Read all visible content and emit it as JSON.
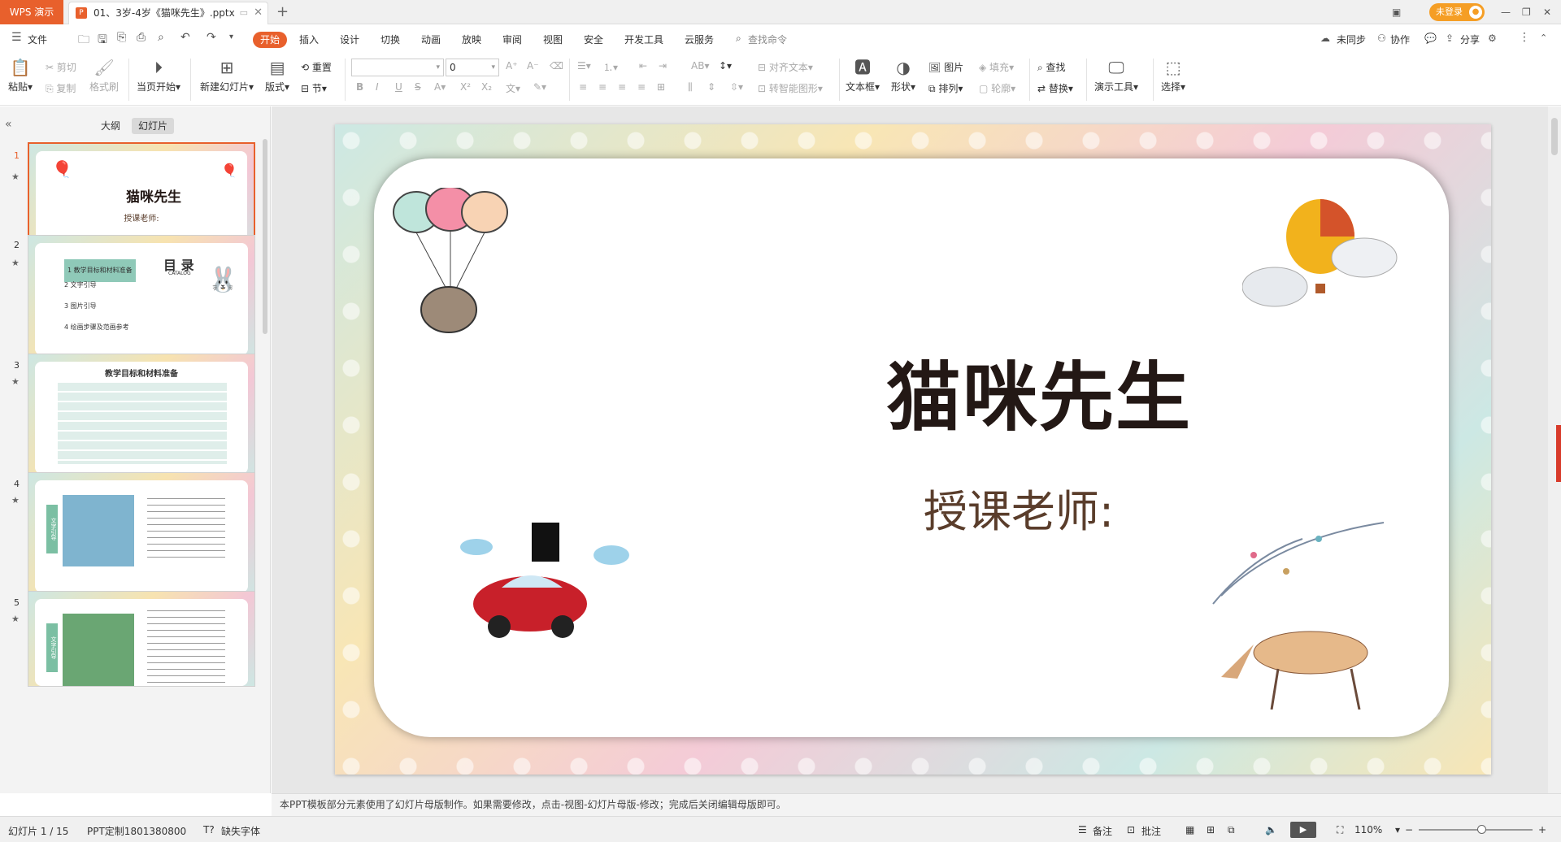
{
  "window": {
    "app_tab": "WPS 演示",
    "doc_tab": "01、3岁-4岁《猫咪先生》.pptx",
    "login_label": "未登录",
    "colors": {
      "accent": "#e8602c",
      "login": "#f59e25",
      "slide_title": "#231815",
      "slide_sub": "#5a3d2b"
    }
  },
  "menu": {
    "file": "文件",
    "items": [
      "开始",
      "插入",
      "设计",
      "切换",
      "动画",
      "放映",
      "审阅",
      "视图",
      "安全",
      "开发工具",
      "云服务"
    ],
    "search": "查找命令",
    "right": {
      "sync": "未同步",
      "collab": "协作",
      "share": "分享"
    }
  },
  "ribbon": {
    "paste": "粘贴",
    "cut": "剪切",
    "copy": "复制",
    "format_painter": "格式刷",
    "play_from_current": "当页开始",
    "new_slide": "新建幻灯片",
    "layout": "版式",
    "reset": "重置",
    "section": "节",
    "font_size": "0",
    "align_text": "对齐文本",
    "smartart": "转智能图形",
    "textbox": "文本框",
    "shape": "形状",
    "picture": "图片",
    "arrange": "排列",
    "fill": "填充",
    "outline": "轮廓",
    "find": "查找",
    "replace": "替换",
    "present_tools": "演示工具",
    "select": "选择"
  },
  "pane": {
    "tab_outline": "大纲",
    "tab_slides": "幻灯片",
    "slides": [
      {
        "num": "1",
        "title": "猫咪先生",
        "sub": "授课老师:"
      },
      {
        "num": "2",
        "title": "目 录",
        "sub": "CATALOG",
        "items": [
          "1 教学目标和材料准备",
          "2 文字引导",
          "3 图片引导",
          "4 绘画步骤及范画参考"
        ]
      },
      {
        "num": "3",
        "title": "教学目标和材料准备"
      },
      {
        "num": "4",
        "label": "文字引导"
      },
      {
        "num": "5",
        "label": "文字引导"
      }
    ]
  },
  "slide": {
    "title": "猫咪先生",
    "subtitle": "授课老师:"
  },
  "notes": "本PPT模板部分元素使用了幻灯片母版制作。如果需要修改，点击-视图-幻灯片母版-修改；完成后关闭编辑母版即可。",
  "status": {
    "slide_counter": "幻灯片 1 / 15",
    "template": "PPT定制1801380800",
    "missing_font": "缺失字体",
    "notes_btn": "备注",
    "comment_btn": "批注",
    "zoom": "110%",
    "zoom_fraction": 0.55
  }
}
